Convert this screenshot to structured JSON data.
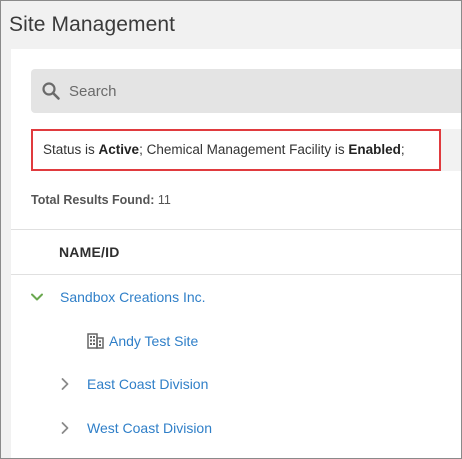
{
  "header": {
    "title": "Site Management"
  },
  "search": {
    "placeholder": "Search",
    "value": ""
  },
  "filter": {
    "status_prefix": "Status is ",
    "status_value": "Active",
    "separator": "; ",
    "facility_prefix": "Chemical Management Facility is ",
    "facility_value": "Enabled",
    "suffix": ";"
  },
  "results": {
    "label": "Total Results Found:",
    "count": "11"
  },
  "table": {
    "column_header": "NAME/ID"
  },
  "tree": {
    "items": [
      {
        "label": "Sandbox Creations Inc.",
        "state": "expanded",
        "icon": "chevron-down-icon"
      },
      {
        "label": "Andy Test Site",
        "state": "child",
        "icon": "building-icon"
      },
      {
        "label": "East Coast Division",
        "state": "collapsed",
        "icon": "chevron-right-icon"
      },
      {
        "label": "West Coast Division",
        "state": "collapsed",
        "icon": "chevron-right-icon"
      }
    ]
  },
  "colors": {
    "link": "#2f7fc8",
    "expand_chevron": "#6aa84f",
    "highlight_border": "#e03a3e"
  }
}
